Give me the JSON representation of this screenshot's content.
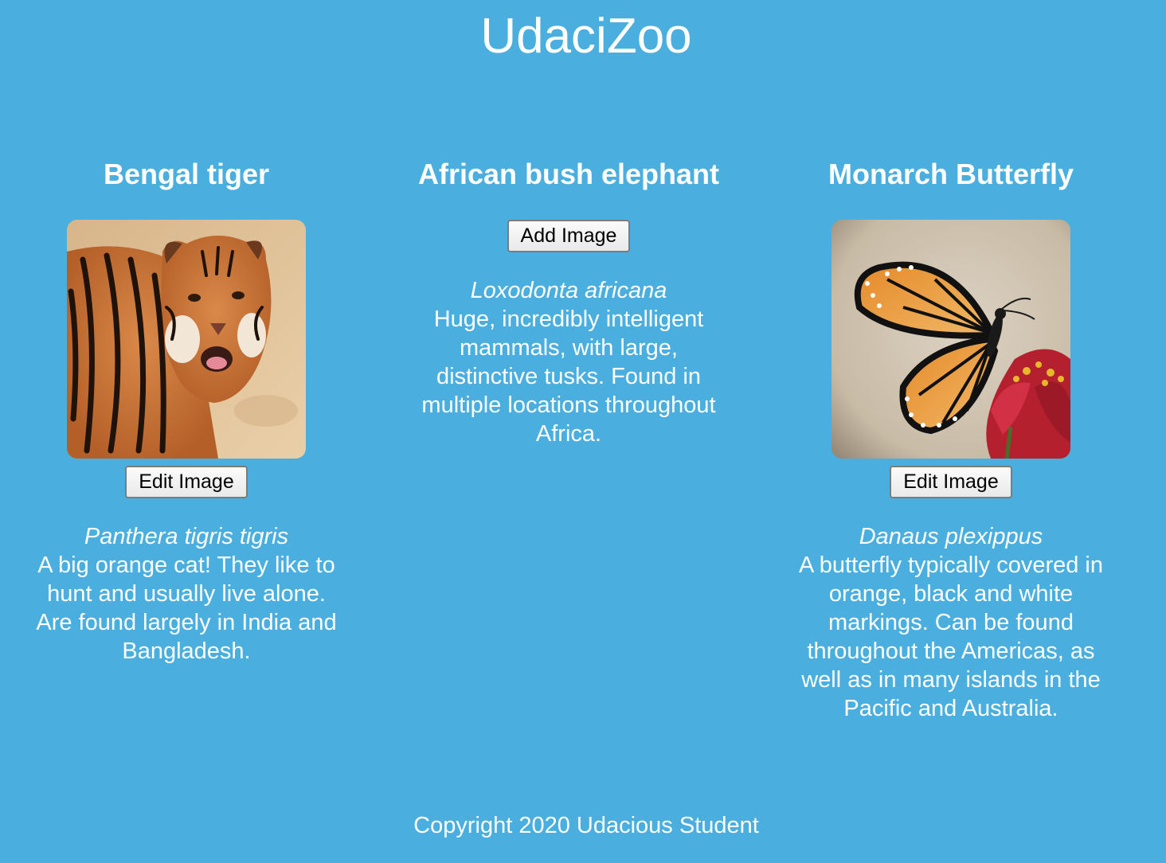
{
  "app": {
    "title": "UdaciZoo"
  },
  "animals": [
    {
      "name": "Bengal tiger",
      "species": "Panthera tigris tigris",
      "description": "A big orange cat! They like to hunt and usually live alone. Are found largely in India and Bangladesh.",
      "image": "tiger-photo",
      "button_label": "Edit Image"
    },
    {
      "name": "African bush elephant",
      "species": "Loxodonta africana",
      "description": "Huge, incredibly intelligent mammals, with large, distinctive tusks. Found in multiple locations throughout Africa.",
      "image": null,
      "button_label": "Add Image"
    },
    {
      "name": "Monarch Butterfly",
      "species": "Danaus plexippus",
      "description": "A butterfly typically covered in orange, black and white markings. Can be found throughout the Americas, as well as in many islands in the Pacific and Australia.",
      "image": "butterfly-photo",
      "button_label": "Edit Image"
    }
  ],
  "footer": {
    "text": "Copyright 2020 Udacious Student"
  },
  "colors": {
    "background": "#4aaedf",
    "text": "#ffffff"
  }
}
